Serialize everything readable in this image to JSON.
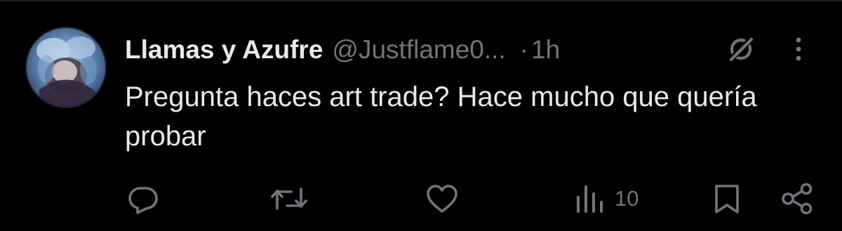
{
  "tweet": {
    "display_name": "Llamas y Azufre",
    "handle": "@Justflame0...",
    "separator": "·",
    "time": "1h",
    "text": "Pregunta haces art trade? Hace mucho que quería probar"
  },
  "actions": {
    "views_count": "10"
  },
  "icons": {
    "reply": "reply-icon",
    "retweet": "retweet-icon",
    "like": "heart-icon",
    "views": "views-chart-icon",
    "bookmark": "bookmark-icon",
    "share": "share-icon",
    "grok": "grok-icon",
    "more": "more-icon"
  },
  "colors": {
    "background": "#000000",
    "primary_text": "#e7e9ea",
    "secondary_text": "#71767b",
    "divider": "#1f2326"
  }
}
